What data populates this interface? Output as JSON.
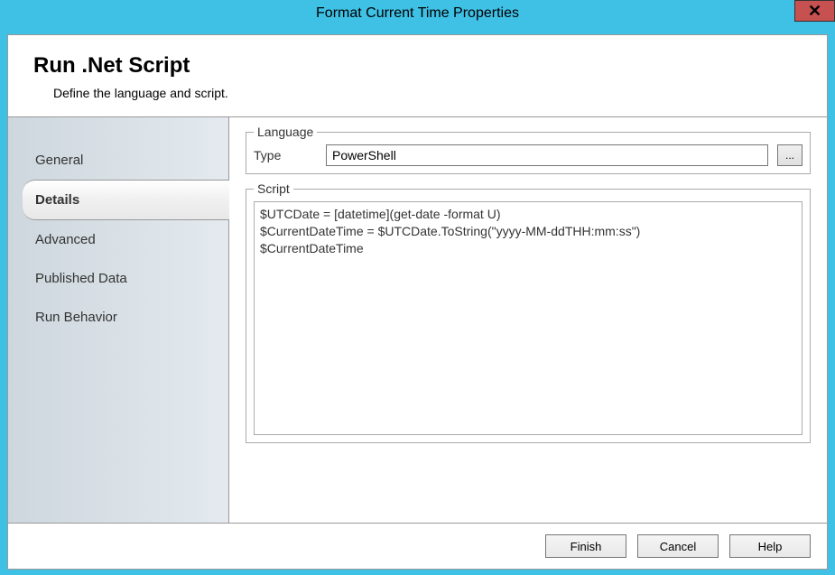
{
  "window": {
    "title": "Format Current Time Properties"
  },
  "header": {
    "title": "Run .Net Script",
    "subtitle": "Define the language and script."
  },
  "sidebar": {
    "items": [
      {
        "label": "General",
        "active": false
      },
      {
        "label": "Details",
        "active": true
      },
      {
        "label": "Advanced",
        "active": false
      },
      {
        "label": "Published Data",
        "active": false
      },
      {
        "label": "Run Behavior",
        "active": false
      }
    ]
  },
  "panel": {
    "language": {
      "legend": "Language",
      "type_label": "Type",
      "type_value": "PowerShell",
      "browse_label": "..."
    },
    "script": {
      "legend": "Script",
      "content": "$UTCDate = [datetime](get-date -format U)\n$CurrentDateTime = $UTCDate.ToString(\"yyyy-MM-ddTHH:mm:ss\")\n$CurrentDateTime"
    }
  },
  "buttons": {
    "finish": "Finish",
    "cancel": "Cancel",
    "help": "Help"
  }
}
